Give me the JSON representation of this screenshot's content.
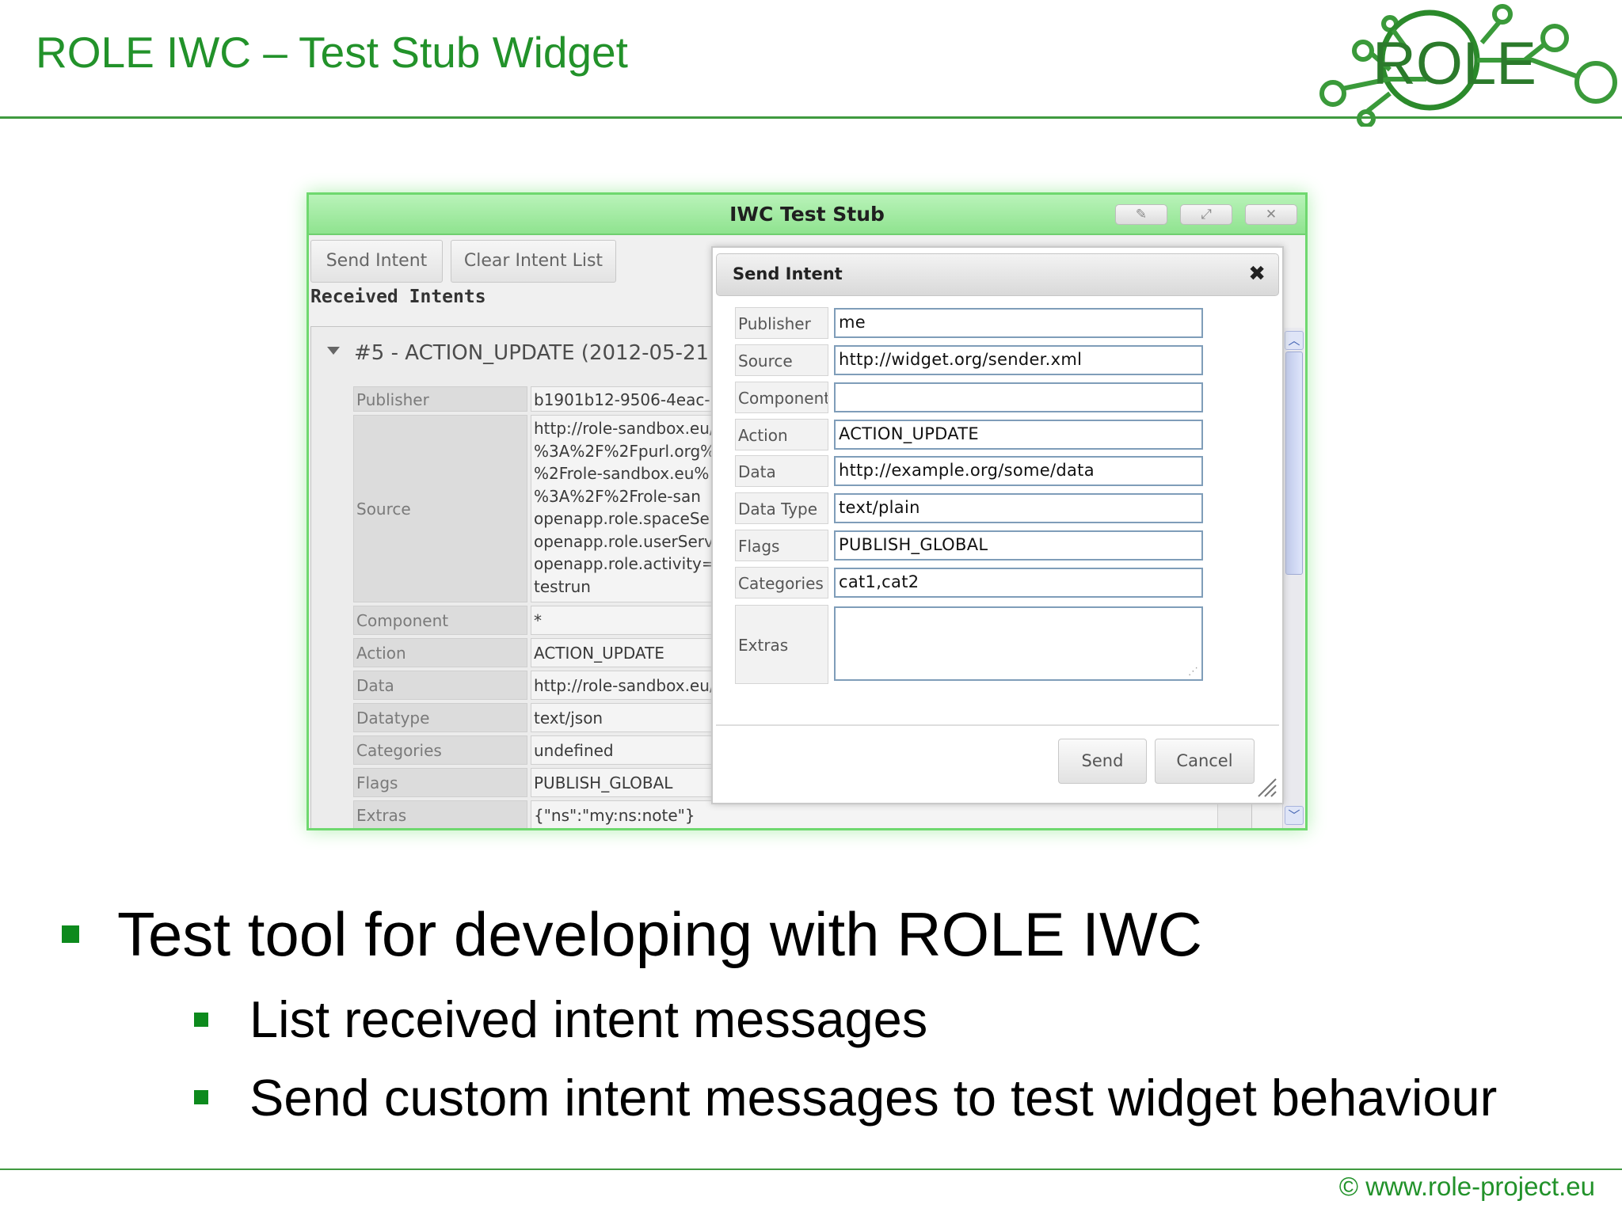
{
  "slide": {
    "title": "ROLE IWC – Test Stub Widget",
    "footer": "© www.role-project.eu",
    "logo_text": "ROLE"
  },
  "widget": {
    "title": "IWC Test Stub",
    "titlebar_buttons": [
      "edit-icon",
      "maximize-icon",
      "close-icon"
    ],
    "send_intent_label": "Send Intent",
    "clear_intent_list_label": "Clear Intent List",
    "received_title": "Received Intents",
    "intent": {
      "header": "#5 - ACTION_UPDATE (2012-05-21",
      "rows": [
        {
          "label": "Publisher",
          "value": "b1901b12-9506-4eac-"
        },
        {
          "label": "Source",
          "value_lines": [
            "http://role-sandbox.eu/",
            "%3A%2F%2Fpurl.org%",
            "%2Frole-sandbox.eu%",
            "%3A%2F%2Frole-san",
            "openapp.role.spaceSe",
            "openapp.role.userServ",
            "openapp.role.activity=r",
            "testrun"
          ]
        },
        {
          "label": "Component",
          "value": "*"
        },
        {
          "label": "Action",
          "value": "ACTION_UPDATE"
        },
        {
          "label": "Data",
          "value": "http://role-sandbox.eu/"
        },
        {
          "label": "Datatype",
          "value": "text/json"
        },
        {
          "label": "Categories",
          "value": "undefined"
        },
        {
          "label": "Flags",
          "value": "PUBLISH_GLOBAL"
        },
        {
          "label": "Extras",
          "value": "{\"ns\":\"my:ns:note\"}"
        }
      ]
    }
  },
  "dialog": {
    "title": "Send Intent",
    "close_glyph": "✖",
    "fields": [
      {
        "label": "Publisher",
        "value": "me"
      },
      {
        "label": "Source",
        "value": "http://widget.org/sender.xml"
      },
      {
        "label": "Component",
        "value": ""
      },
      {
        "label": "Action",
        "value": "ACTION_UPDATE"
      },
      {
        "label": "Data",
        "value": "http://example.org/some/data"
      },
      {
        "label": "Data Type",
        "value": "text/plain"
      },
      {
        "label": "Flags",
        "value": "PUBLISH_GLOBAL"
      },
      {
        "label": "Categories",
        "value": "cat1,cat2"
      }
    ],
    "extras_label": "Extras",
    "extras_value": "",
    "send_label": "Send",
    "cancel_label": "Cancel"
  },
  "bullets": {
    "main": "Test tool for developing with ROLE IWC",
    "subs": [
      "List received intent messages",
      "Send custom intent messages to test widget behaviour"
    ]
  },
  "colors": {
    "accent_green": "#22922a",
    "bullet_green": "#0d8a1d",
    "widget_border": "#6fd86f"
  }
}
